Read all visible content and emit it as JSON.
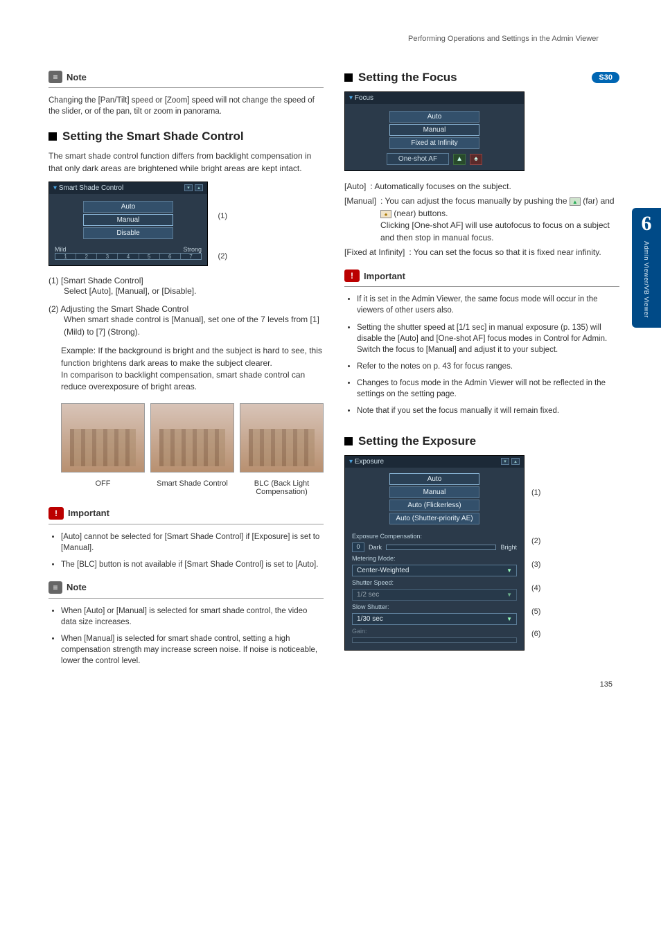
{
  "header": {
    "path": "Performing Operations and Settings in the Admin Viewer"
  },
  "tab": {
    "number": "6",
    "label": "Admin Viewer/VB Viewer"
  },
  "page_number": "135",
  "left": {
    "note1": {
      "label": "Note",
      "text": "Changing the [Pan/Tilt] speed or [Zoom] speed will not change the speed of the slider, or of the pan, tilt or zoom in panorama."
    },
    "smart_shade": {
      "title": "Setting the Smart Shade Control",
      "intro": "The smart shade control function differs from backlight compensation in that only dark areas are brightened while bright areas are kept intact.",
      "panel": {
        "title": "Smart Shade Control",
        "options": [
          "Auto",
          "Manual",
          "Disable"
        ],
        "mild": "Mild",
        "strong": "Strong",
        "levels": [
          "1",
          "2",
          "3",
          "4",
          "5",
          "6",
          "7"
        ]
      },
      "annotations": {
        "a1": "(1)",
        "a2": "(2)"
      },
      "item1_label": "(1) [Smart Shade Control]",
      "item1_body": "Select [Auto], [Manual], or [Disable].",
      "item2_label": "(2) Adjusting the Smart Shade Control",
      "item2_body": "When smart shade control is [Manual], set one of the 7 levels from [1] (Mild) to [7] (Strong).",
      "example": "Example: If the background is bright and the subject is hard to see, this function brightens dark areas to make the subject clearer.\nIn comparison to backlight compensation, smart shade control can reduce overexposure of bright areas.",
      "captions": [
        "OFF",
        "Smart Shade Control",
        "BLC (Back Light Compensation)"
      ]
    },
    "important": {
      "label": "Important",
      "items": [
        "[Auto] cannot be selected for [Smart Shade Control] if [Exposure] is set to [Manual].",
        "The [BLC] button is not available if [Smart Shade Control] is set to [Auto]."
      ]
    },
    "note2": {
      "label": "Note",
      "items": [
        "When [Auto] or [Manual] is selected for smart shade control, the video data size increases.",
        "When [Manual] is selected for smart shade control, setting a high compensation strength may increase screen noise. If noise is noticeable, lower the control level."
      ]
    }
  },
  "right": {
    "focus": {
      "title": "Setting the Focus",
      "badge": "S30",
      "panel": {
        "title": "Focus",
        "options": [
          "Auto",
          "Manual",
          "Fixed at Infinity"
        ],
        "oneShot": "One-shot AF"
      },
      "defs": {
        "auto_term": "[Auto]",
        "auto_body": ": Automatically focuses on the subject.",
        "manual_term": "[Manual]",
        "manual_body1": ": You can adjust the focus manually by pushing the ",
        "manual_far": "(far) and",
        "manual_near": "(near) buttons.",
        "manual_body2": "Clicking [One-shot AF] will use autofocus to focus on a subject and then stop in manual focus.",
        "inf_term": "[Fixed at Infinity]",
        "inf_body": ": You can set the focus so that it is fixed near infinity."
      }
    },
    "important": {
      "label": "Important",
      "items": [
        "If it is set in the Admin Viewer, the same focus mode will occur in the viewers of other users also.",
        "Setting the shutter speed at [1/1 sec] in manual exposure (p. 135) will disable the [Auto] and [One-shot AF] focus modes in Control for Admin. Switch the focus to [Manual] and adjust it to your subject.",
        "Refer to the notes on p. 43 for focus ranges.",
        "Changes to focus mode in the Admin Viewer will not be reflected in the settings on the setting page.",
        "Note that if you set the focus manually it will remain fixed."
      ]
    },
    "exposure": {
      "title": "Setting the Exposure",
      "panel": {
        "title": "Exposure",
        "options": [
          "Auto",
          "Manual",
          "Auto (Flickerless)",
          "Auto (Shutter-priority AE)"
        ],
        "expComp": "Exposure Compensation:",
        "expZero": "0",
        "dark": "Dark",
        "bright": "Bright",
        "metering": "Metering Mode:",
        "meteringVal": "Center-Weighted",
        "shutter": "Shutter Speed:",
        "shutterVal": "1/2 sec",
        "slow": "Slow Shutter:",
        "slowVal": "1/30 sec",
        "gain": "Gain:"
      },
      "annotations": [
        "(1)",
        "(2)",
        "(3)",
        "(4)",
        "(5)",
        "(6)"
      ]
    }
  }
}
